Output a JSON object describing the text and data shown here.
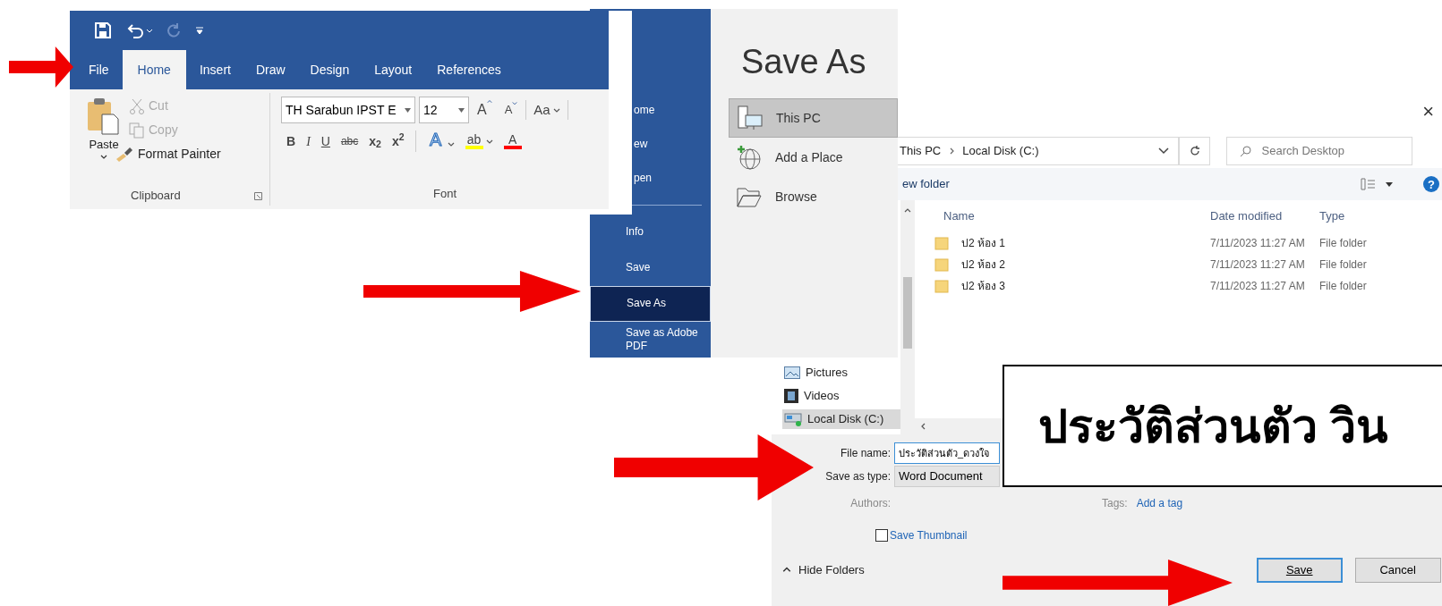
{
  "ribbon": {
    "tabs": [
      {
        "label": "File",
        "selected": false
      },
      {
        "label": "Home",
        "selected": true
      },
      {
        "label": "Insert",
        "selected": false
      },
      {
        "label": "Draw",
        "selected": false
      },
      {
        "label": "Design",
        "selected": false
      },
      {
        "label": "Layout",
        "selected": false
      },
      {
        "label": "References",
        "selected": false
      }
    ],
    "clipboard": {
      "paste": "Paste",
      "cut": "Cut",
      "copy": "Copy",
      "format_painter": "Format Painter",
      "label": "Clipboard"
    },
    "font": {
      "name": "TH Sarabun IPST E",
      "size": "12",
      "grow_shrink": [
        "A",
        "A"
      ],
      "case_button": "Aa",
      "format_buttons": [
        "B",
        "I",
        "U",
        "abc",
        "x$_{2}$",
        "x$^{2}$"
      ],
      "color_buttons": [
        {
          "label": "A",
          "kind": "effects"
        },
        {
          "label": "ab",
          "kind": "highlight"
        },
        {
          "label": "A",
          "kind": "color"
        }
      ],
      "label": "Font"
    }
  },
  "backstage": {
    "nav": [
      {
        "label": "ome",
        "selected": false
      },
      {
        "label": "ew",
        "selected": false
      },
      {
        "label": "pen",
        "selected": false
      },
      {
        "label": "Info",
        "selected": false
      },
      {
        "label": "Save",
        "selected": false
      },
      {
        "label": "Save As",
        "selected": true
      },
      {
        "label": "Save as Adobe PDF",
        "selected": false
      }
    ],
    "title": "Save As",
    "places": [
      {
        "label": "This PC",
        "selected": true,
        "kind": "pc"
      },
      {
        "label": "Add a Place",
        "selected": false,
        "kind": "web"
      },
      {
        "label": "Browse",
        "selected": false,
        "kind": "folder"
      }
    ]
  },
  "dialog": {
    "close": "×",
    "help": "?",
    "breadcrumb": [
      "This PC",
      "Local Disk (C:)"
    ],
    "search_placeholder": "Search Desktop",
    "toolbar_label": "ew folder",
    "columns": [
      "Name",
      "Date modified",
      "Type"
    ],
    "rows": [
      {
        "name": "ป2 ห้อง 1",
        "date": "7/11/2023 11:27 AM",
        "type": "File folder"
      },
      {
        "name": "ป2 ห้อง 2",
        "date": "7/11/2023 11:27 AM",
        "type": "File folder"
      },
      {
        "name": "ป2 ห้อง 3",
        "date": "7/11/2023 11:27 AM",
        "type": "File folder"
      }
    ],
    "nav": [
      {
        "label": "Pictures",
        "selected": false,
        "kind": "pictures"
      },
      {
        "label": "Videos",
        "selected": false,
        "kind": "videos"
      },
      {
        "label": "Local Disk (C:)",
        "selected": true,
        "kind": "disk"
      }
    ],
    "file_name": {
      "label": "File name:",
      "value": "ประวัติส่วนตัว_ดวงใจ"
    },
    "save_type": {
      "label": "Save as type:",
      "value": "Word Document"
    },
    "authors_label": "Authors:",
    "tags_label": "Tags:",
    "tags_link": "Add a tag",
    "thumbnail": {
      "label": "Save Thumbnail",
      "checked": false
    },
    "hide_folders": "Hide Folders",
    "buttons": [
      "Save",
      "Cancel"
    ]
  },
  "overlay": {
    "text": "ประวัติส่วนตัว วิน"
  }
}
